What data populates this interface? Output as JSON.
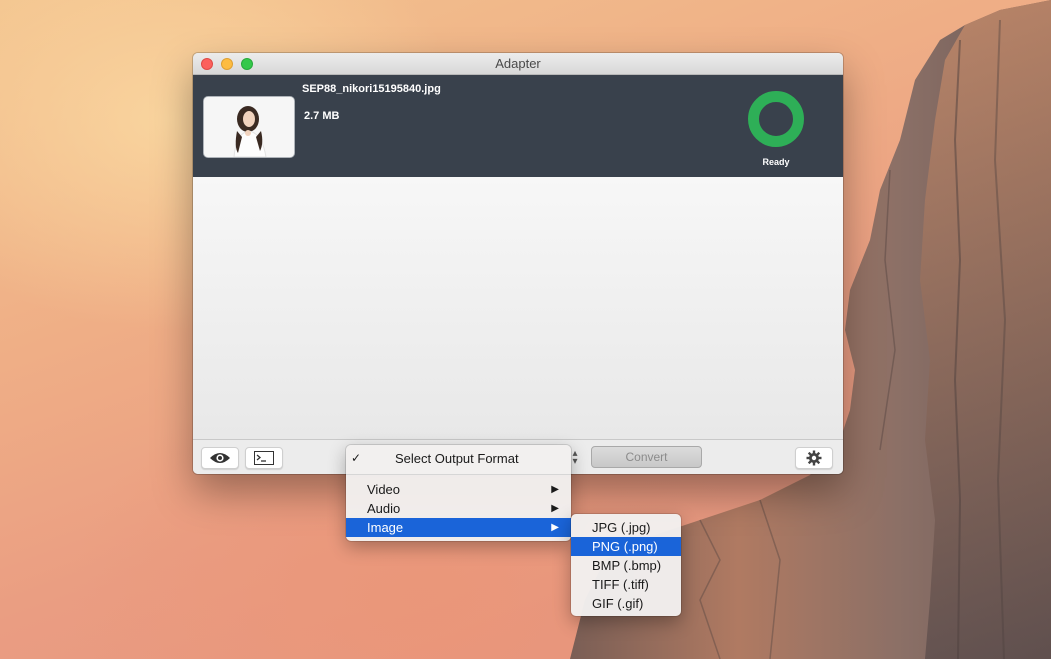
{
  "window": {
    "title": "Adapter"
  },
  "file": {
    "name": "SEP88_nikori15195840.jpg",
    "size": "2.7 MB",
    "status": "Ready",
    "progress": 1.0
  },
  "toolbar": {
    "convert_label": "Convert",
    "preview_icon": "eye-icon",
    "terminal_icon": "terminal-icon",
    "settings_icon": "gear-icon"
  },
  "format_menu": {
    "header": "Select Output Format",
    "checkmark": "✓",
    "items": [
      {
        "label": "Video",
        "arrow": "▶"
      },
      {
        "label": "Audio",
        "arrow": "▶"
      },
      {
        "label": "Image",
        "arrow": "▶"
      }
    ]
  },
  "image_submenu": {
    "items": [
      "JPG (.jpg)",
      "PNG (.png)",
      "BMP (.bmp)",
      "TIFF (.tiff)",
      "GIF (.gif)"
    ],
    "selected": "PNG (.png)"
  },
  "colors": {
    "accent": "#1a64d9",
    "ready_ring": "#2eaf57",
    "header_bg": "#39414c"
  }
}
